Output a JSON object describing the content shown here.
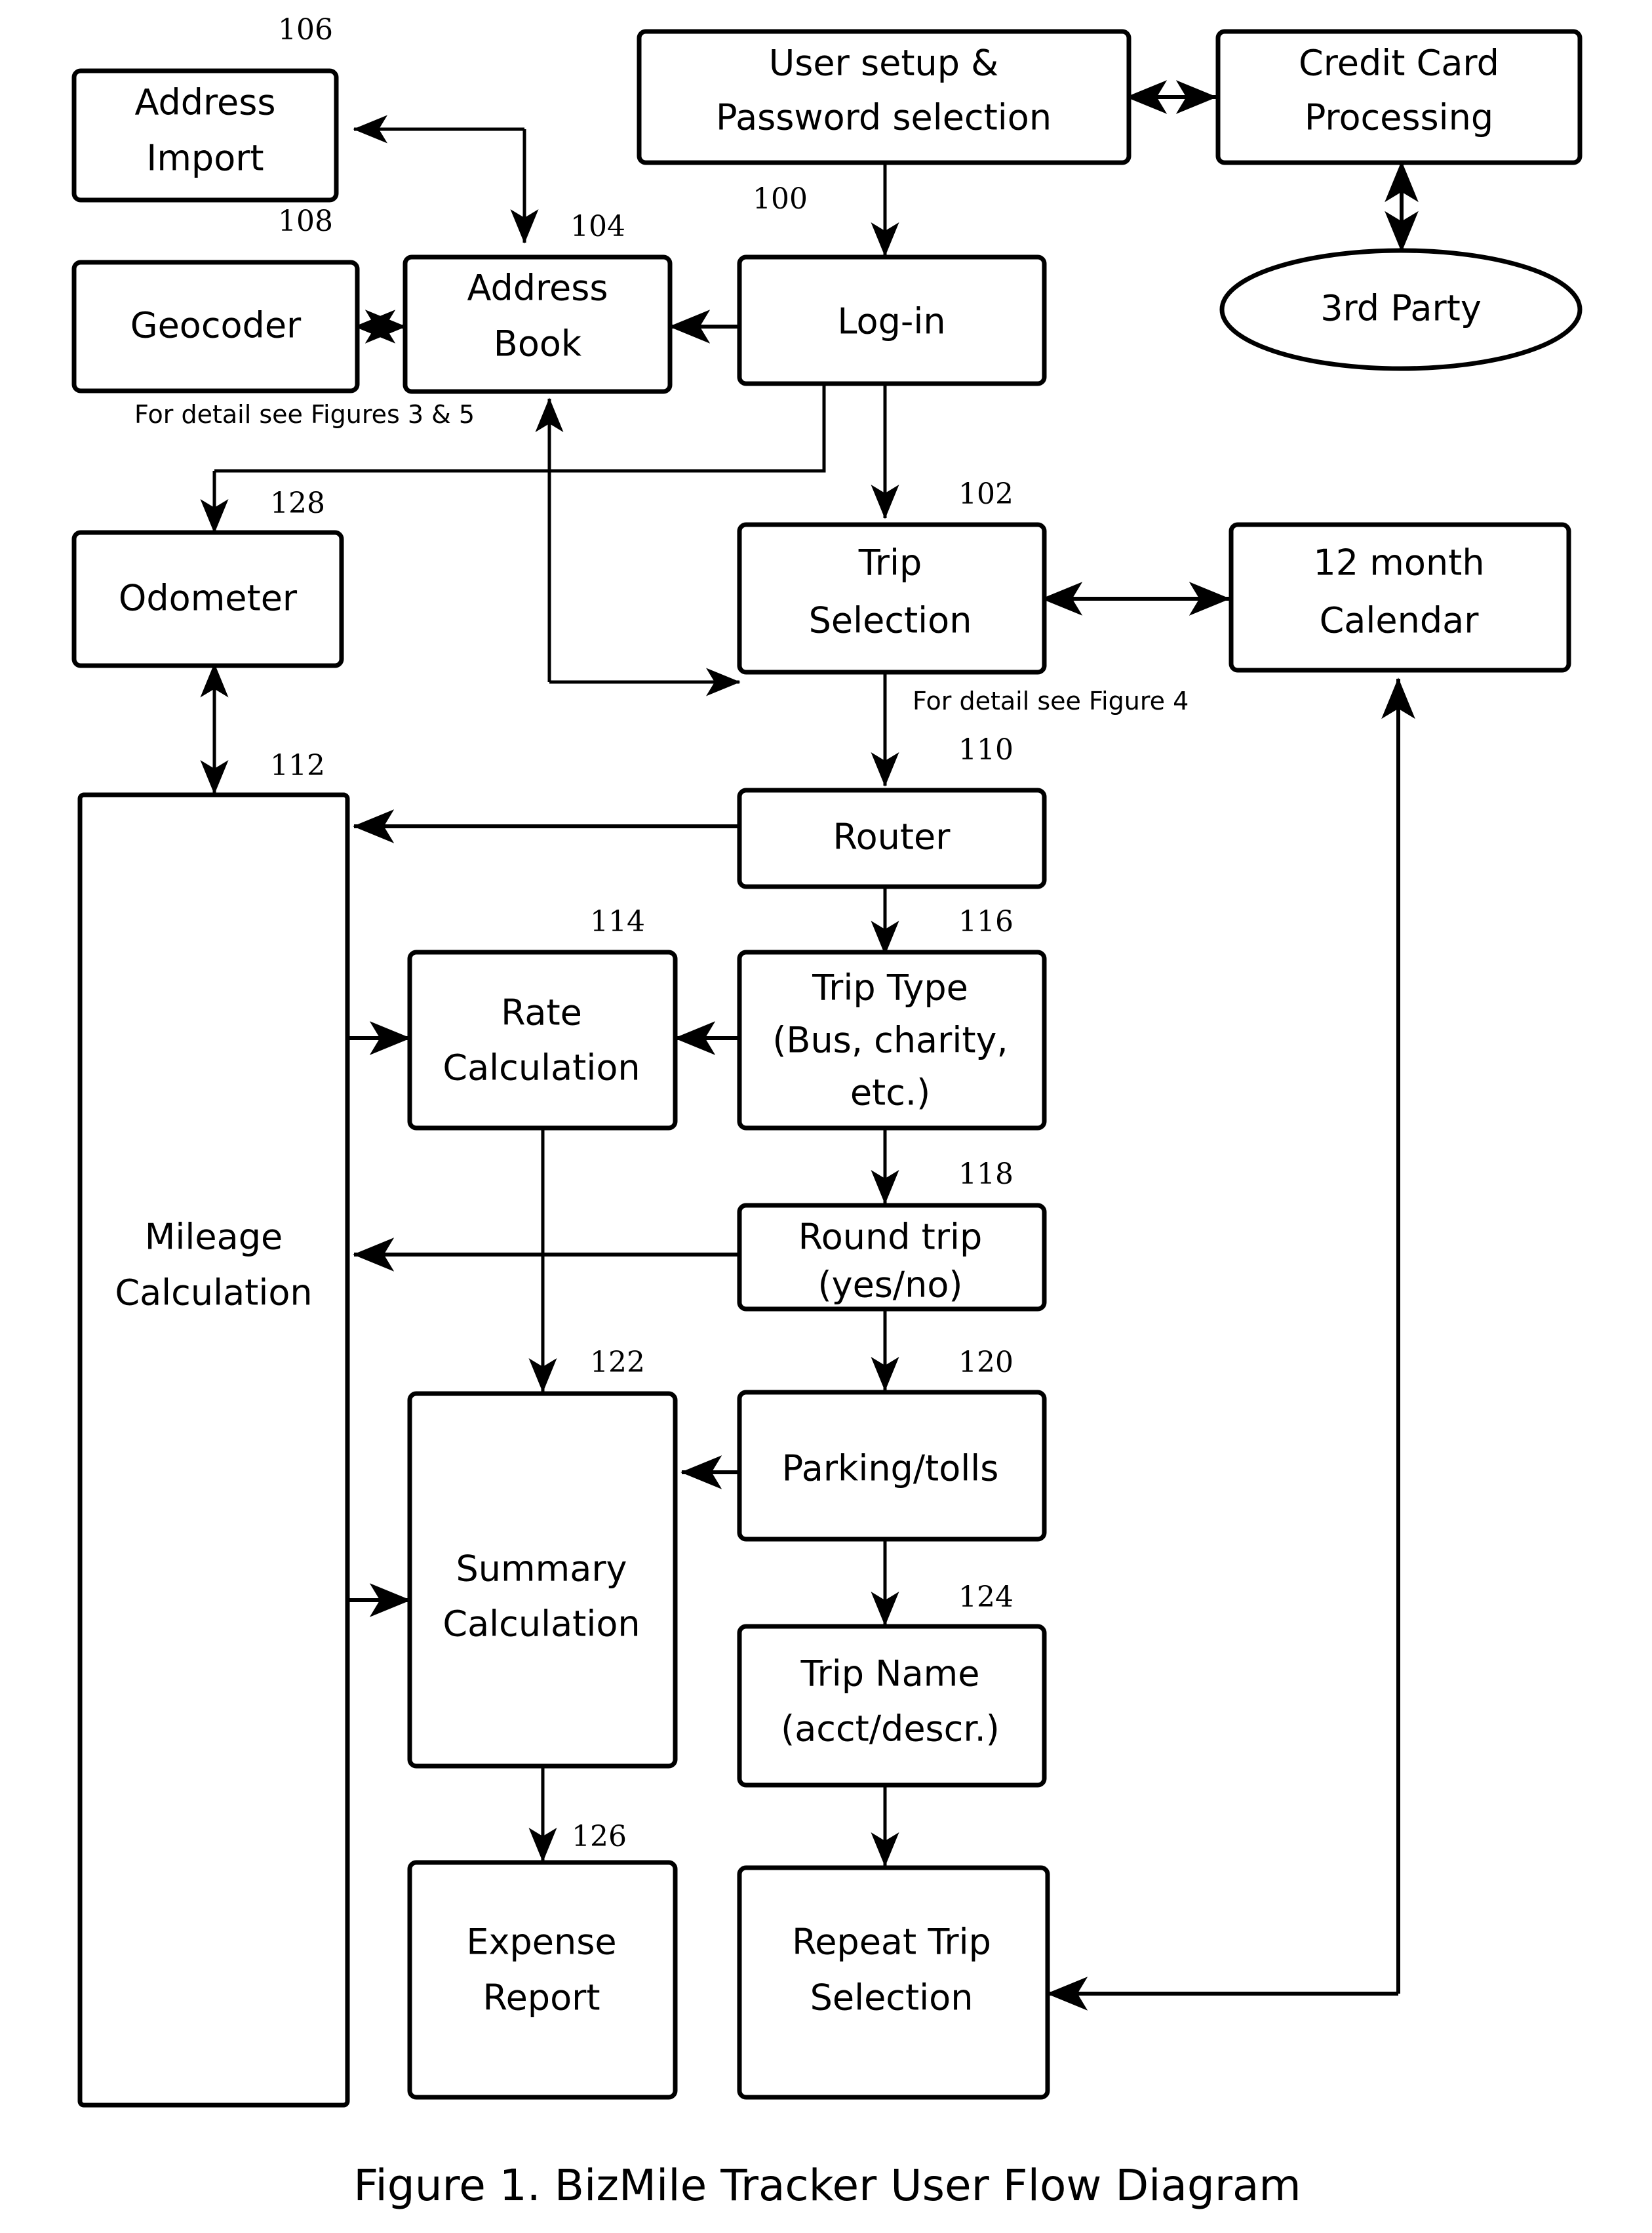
{
  "figure": {
    "caption": "Figure 1. BizMile Tracker User Flow Diagram",
    "notes": {
      "detail_3_5": "For detail see Figures 3 & 5",
      "detail_4": "For detail see Figure 4"
    }
  },
  "nodes": {
    "user_setup": {
      "label_line1": "User setup &",
      "label_line2": "Password selection",
      "ref": "100"
    },
    "credit_card": {
      "label_line1": "Credit Card",
      "label_line2": "Processing",
      "ref": ""
    },
    "third_party": {
      "label": "3rd Party",
      "ref": ""
    },
    "address_import": {
      "label_line1": "Address",
      "label_line2": "Import",
      "ref": "106"
    },
    "geocoder": {
      "label": "Geocoder",
      "ref": "108"
    },
    "address_book": {
      "label_line1": "Address",
      "label_line2": "Book",
      "ref": "104"
    },
    "login": {
      "label": "Log-in",
      "ref": ""
    },
    "trip_selection": {
      "label_line1": "Trip",
      "label_line2": "Selection",
      "ref": "102"
    },
    "calendar": {
      "label_line1": "12 month",
      "label_line2": "Calendar",
      "ref": ""
    },
    "odometer": {
      "label": "Odometer",
      "ref": "128"
    },
    "mileage_calculation": {
      "label_line1": "Mileage",
      "label_line2": "Calculation",
      "ref": "112"
    },
    "router": {
      "label": "Router",
      "ref": "110"
    },
    "rate_calculation": {
      "label_line1": "Rate",
      "label_line2": "Calculation",
      "ref": "114"
    },
    "trip_type": {
      "label_line1": "Trip Type",
      "label_line2": "(Bus, charity,",
      "label_line3": "etc.)",
      "ref": "116"
    },
    "round_trip": {
      "label_line1": "Round trip",
      "label_line2": "(yes/no)",
      "ref": "118"
    },
    "parking_tolls": {
      "label": "Parking/tolls",
      "ref": "120"
    },
    "summary_calculation": {
      "label_line1": "Summary",
      "label_line2": "Calculation",
      "ref": "122"
    },
    "trip_name": {
      "label_line1": "Trip Name",
      "label_line2": "(acct/descr.)",
      "ref": "124"
    },
    "expense_report": {
      "label_line1": "Expense",
      "label_line2": "Report",
      "ref": "126"
    },
    "repeat_trip": {
      "label_line1": "Repeat Trip",
      "label_line2": "Selection",
      "ref": ""
    }
  },
  "colors": {
    "stroke": "#000000",
    "fill": "#ffffff",
    "text": "#000000"
  }
}
